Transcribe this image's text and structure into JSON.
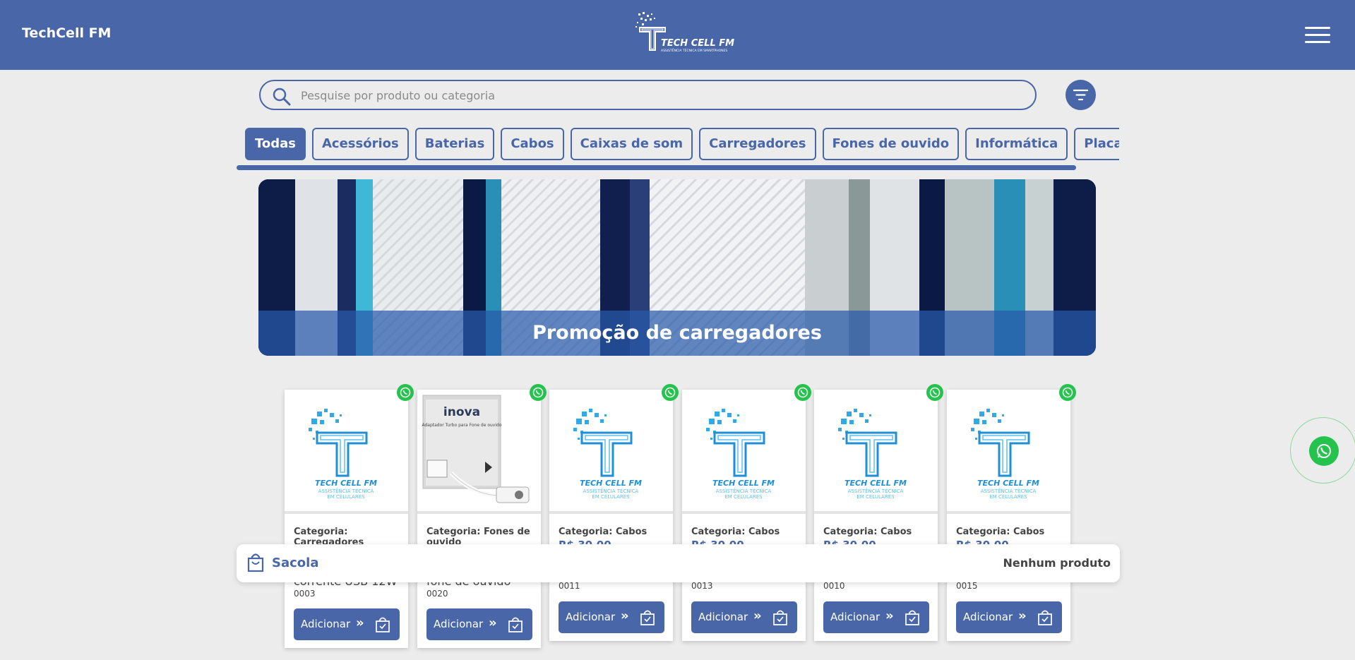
{
  "header": {
    "brand": "TechCell FM",
    "logo_text": "TECH CELL FM",
    "logo_subtext": "ASSISTÊNCIA TÉCNICA EM SMARTPHONES"
  },
  "search": {
    "placeholder": "Pesquise por produto ou categoria"
  },
  "categories": [
    {
      "label": "Todas",
      "active": true
    },
    {
      "label": "Acessórios"
    },
    {
      "label": "Baterias"
    },
    {
      "label": "Cabos"
    },
    {
      "label": "Caixas de som"
    },
    {
      "label": "Carregadores"
    },
    {
      "label": "Fones de ouvido"
    },
    {
      "label": "Informática"
    },
    {
      "label": "Placas sub"
    }
  ],
  "banner": {
    "caption": "Promoção de carregadores"
  },
  "products": [
    {
      "category": "Categoria: Carregadores",
      "name": "corrente USB 12W",
      "code": "0003",
      "add_label": "Adicionar",
      "image": "logo"
    },
    {
      "category": "Categoria: Fones de ouvido",
      "name": "fone de ouvido",
      "code": "0020",
      "add_label": "Adicionar",
      "image": "inova-adapter",
      "brand": "inova",
      "box_text": "Adaptador Turbo para Fone de ouvido"
    },
    {
      "category": "Categoria: Cabos",
      "price": "R$ 30,00",
      "code": "0011",
      "add_label": "Adicionar",
      "image": "logo"
    },
    {
      "category": "Categoria: Cabos",
      "price": "R$ 30,00",
      "code": "0013",
      "add_label": "Adicionar",
      "image": "logo"
    },
    {
      "category": "Categoria: Cabos",
      "price": "R$ 30,00",
      "code": "0010",
      "add_label": "Adicionar",
      "image": "logo"
    },
    {
      "category": "Categoria: Cabos",
      "price": "R$ 30,00",
      "code": "0015",
      "add_label": "Adicionar",
      "image": "logo"
    }
  ],
  "product_logo": {
    "title": "TECH CELL FM",
    "line1": "ASSISTÊNCIA TÉCNICA",
    "line2": "EM CELULARES"
  },
  "bag": {
    "label": "Sacola",
    "status": "Nenhum produto"
  },
  "icons": {
    "search": "search-icon",
    "filter": "filter-icon",
    "menu": "hamburger-menu-icon",
    "whatsapp": "whatsapp-icon",
    "bag": "shopping-bag-icon",
    "add": "bag-check-icon"
  },
  "colors": {
    "primary": "#4866a8",
    "background": "#ececec",
    "whatsapp": "#25c34d"
  }
}
